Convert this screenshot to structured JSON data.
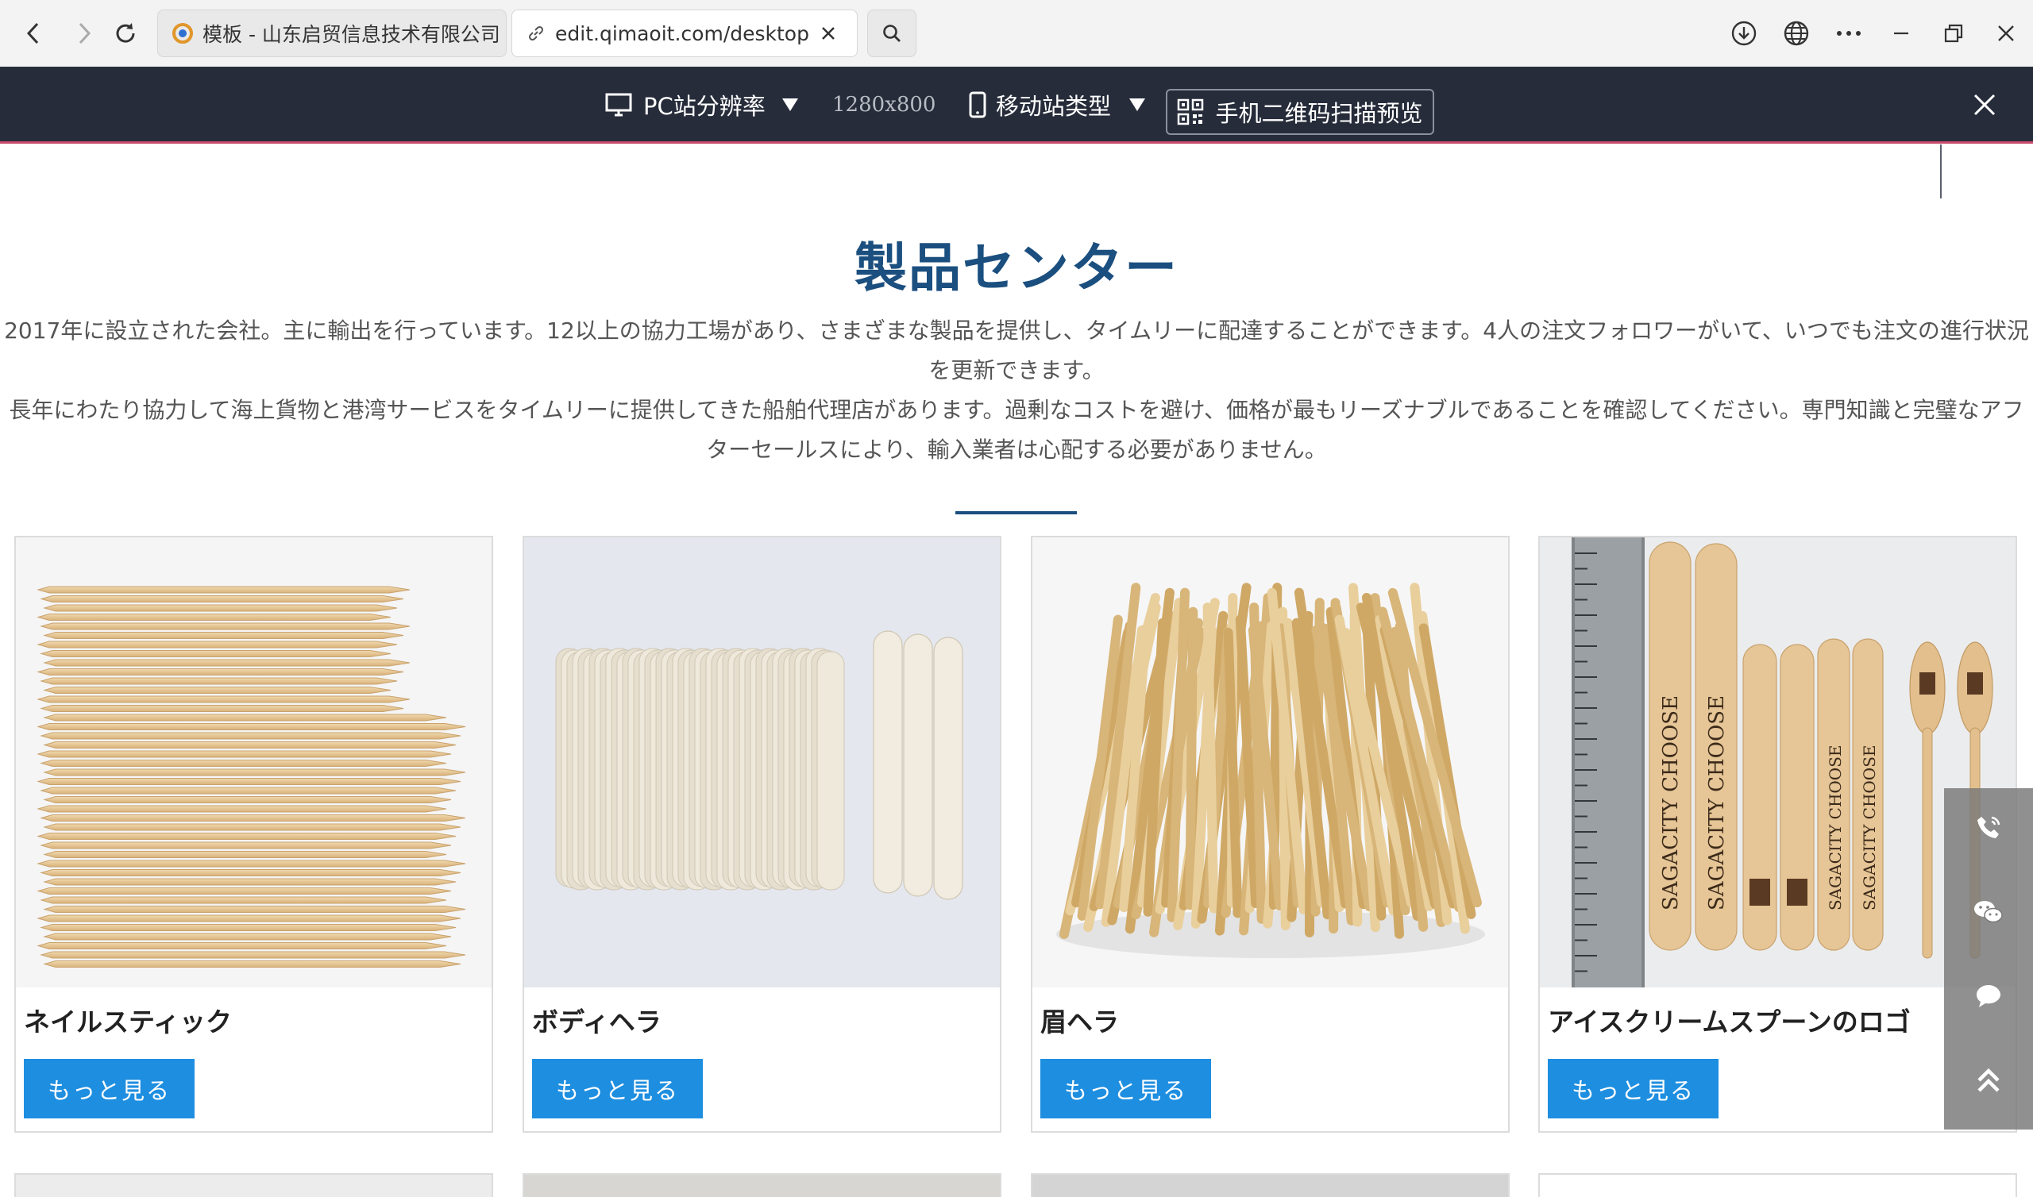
{
  "browser": {
    "tabs": [
      {
        "label": "模板 - 山东启贸信息技术有限公司"
      },
      {
        "label": "edit.qimaoit.com/desktop/h"
      }
    ]
  },
  "preview_toolbar": {
    "pc_resolution_label": "PC站分辨率",
    "resolution_value": "1280x800",
    "mobile_type_label": "移动站类型",
    "qr_preview_label": "手机二维码扫描预览"
  },
  "section": {
    "title": "製品センター",
    "intro_paragraphs": [
      "2017年に設立された会社。主に輸出を行っています。12以上の協力工場があり、さまざまな製品を提供し、タイムリーに配達することができます。4人の注文フォロワーがいて、いつでも注文の進行状況を更新できます。",
      "長年にわたり協力して海上貨物と港湾サービスをタイムリーに提供してきた船舶代理店があります。過剰なコストを避け、価格が最もリーズナブルであることを確認してください。専門知識と完璧なアフターセールスにより、輸入業者は心配する必要がありません。"
    ]
  },
  "products": [
    {
      "name": "ネイルスティック",
      "button": "もっと見る"
    },
    {
      "name": "ボディヘラ",
      "button": "もっと見る"
    },
    {
      "name": "眉ヘラ",
      "button": "もっと見る"
    },
    {
      "name": "アイスクリームスプーンのロゴ",
      "button": "もっと見る",
      "stick_text": "SAGACITY CHOOSE"
    }
  ],
  "icons": {
    "back": "back-arrow-icon",
    "forward": "forward-arrow-icon",
    "reload": "reload-icon",
    "download": "download-icon",
    "globe": "globe-icon",
    "more": "more-icon",
    "monitor": "monitor-icon",
    "phone": "phone-icon",
    "qr": "qr-code-icon",
    "close": "close-icon",
    "side": [
      "phone-call-icon",
      "wechat-icon",
      "message-icon",
      "back-to-top-icon"
    ]
  },
  "colors": {
    "title": "#1b4f7f",
    "button": "#1e8ee0",
    "toolbar": "#262c3a"
  }
}
